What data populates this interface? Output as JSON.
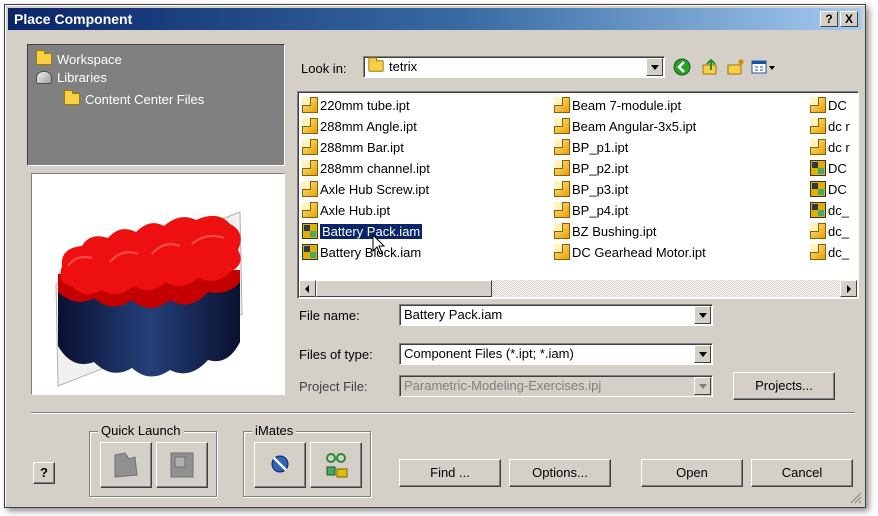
{
  "window": {
    "title": "Place Component",
    "help_btn": "?",
    "close_btn": "X"
  },
  "locations": {
    "items": [
      {
        "label": "Workspace",
        "icon": "folder-icon"
      },
      {
        "label": "Libraries",
        "icon": "libraries-icon"
      },
      {
        "label": "Content Center Files",
        "icon": "folder-icon"
      }
    ]
  },
  "lookin": {
    "label": "Look in:",
    "value": "tetrix"
  },
  "files": {
    "col1": [
      {
        "name": "220mm tube.ipt",
        "type": "part"
      },
      {
        "name": "288mm Angle.ipt",
        "type": "part"
      },
      {
        "name": "288mm Bar.ipt",
        "type": "part"
      },
      {
        "name": "288mm channel.ipt",
        "type": "part"
      },
      {
        "name": "Axle Hub Screw.ipt",
        "type": "part"
      },
      {
        "name": "Axle Hub.ipt",
        "type": "part"
      },
      {
        "name": "Battery Pack.iam",
        "type": "assembly",
        "selected": true
      },
      {
        "name": "Battery Block.iam",
        "type": "assembly"
      }
    ],
    "col2": [
      {
        "name": "Beam 7-module.ipt",
        "type": "part"
      },
      {
        "name": "Beam Angular-3x5.ipt",
        "type": "part"
      },
      {
        "name": "BP_p1.ipt",
        "type": "part"
      },
      {
        "name": "BP_p2.ipt",
        "type": "part"
      },
      {
        "name": "BP_p3.ipt",
        "type": "part"
      },
      {
        "name": "BP_p4.ipt",
        "type": "part"
      },
      {
        "name": "BZ Bushing.ipt",
        "type": "part"
      },
      {
        "name": "DC Gearhead Motor.ipt",
        "type": "part"
      }
    ],
    "col3": [
      {
        "name": "DC",
        "type": "part"
      },
      {
        "name": "dc r",
        "type": "part"
      },
      {
        "name": "dc r",
        "type": "part"
      },
      {
        "name": "DC",
        "type": "assembly"
      },
      {
        "name": "DC",
        "type": "assembly"
      },
      {
        "name": "dc_",
        "type": "assembly"
      },
      {
        "name": "dc_",
        "type": "part"
      },
      {
        "name": "dc_",
        "type": "part"
      }
    ]
  },
  "form": {
    "filename_label": "File name:",
    "filename_value": "Battery Pack.iam",
    "filetype_label": "Files of type:",
    "filetype_value": "Component Files (*.ipt; *.iam)",
    "project_label": "Project File:",
    "project_value": "Parametric-Modeling-Exercises.ipj",
    "projects_button": "Projects..."
  },
  "groups": {
    "quick_launch": "Quick Launch",
    "imates": "iMates"
  },
  "buttons": {
    "help": "?",
    "find": "Find ...",
    "options": "Options...",
    "open": "Open",
    "cancel": "Cancel"
  }
}
